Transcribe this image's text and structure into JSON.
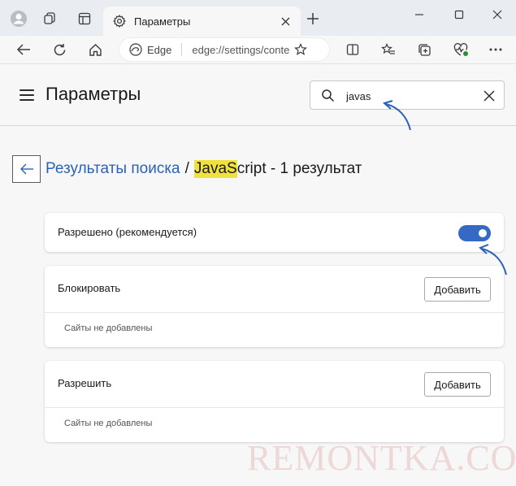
{
  "tab": {
    "title": "Параметры"
  },
  "toolbar": {
    "engine_label": "Edge",
    "url": "edge://settings/content/javascript"
  },
  "header": {
    "title": "Параметры",
    "search_value": "javas"
  },
  "breadcrumb": {
    "link": "Результаты поиска",
    "separator": "/",
    "highlight": "JavaS",
    "term_rest": "cript",
    "suffix": " - 1 результат"
  },
  "allowed": {
    "label": "Разрешено (рекомендуется)",
    "enabled": true
  },
  "block_section": {
    "title": "Блокировать",
    "add_label": "Добавить",
    "empty_text": "Сайты не добавлены"
  },
  "allow_section": {
    "title": "Разрешить",
    "add_label": "Добавить",
    "empty_text": "Сайты не добавлены"
  },
  "watermark": "REMONTKA.COM",
  "colors": {
    "accent": "#3569c3",
    "link": "#2a62b8",
    "highlight": "#f0e23c",
    "annotation_arrow": "#2a62b8"
  }
}
